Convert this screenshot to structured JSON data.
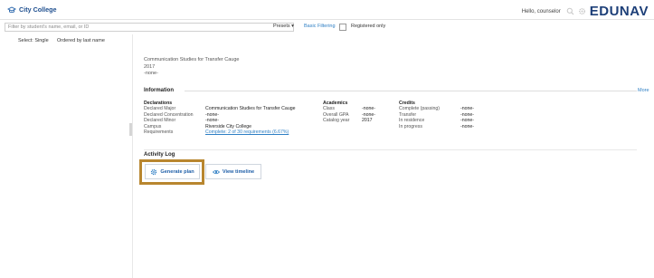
{
  "header": {
    "app_title": "City College",
    "greeting": "Hello, counselor",
    "brand": "EDUNAV"
  },
  "filter": {
    "search_placeholder": "Filter by student's name, email, or ID",
    "presets_label": "Presets ▾",
    "basic_filtering_label": "Basic Filtering",
    "registered_only_label": "Registered only"
  },
  "left_panel": {
    "select_label": "Select: Single",
    "order_label": "Ordered by last name"
  },
  "student": {
    "program": "Communication Studies for Transfer Cauge",
    "year": "2017",
    "extra": "-none-"
  },
  "information": {
    "heading": "Information",
    "more_label": "More",
    "declarations": {
      "heading": "Declarations",
      "rows": [
        {
          "label": "Declared Major",
          "value": "Communication Studies for Transfer Cauge"
        },
        {
          "label": "Declared Concentration",
          "value": "-none-"
        },
        {
          "label": "Declared Minor",
          "value": "-none-"
        },
        {
          "label": "Campus",
          "value": "Riverside City College"
        },
        {
          "label": "Requirements",
          "value": "Complete: 2 of 30 requirements (6.67%)"
        }
      ]
    },
    "academics": {
      "heading": "Academics",
      "rows": [
        {
          "label": "Class",
          "value": "-none-"
        },
        {
          "label": "Overall GPA",
          "value": "-none-"
        },
        {
          "label": "Catalog year",
          "value": "2017"
        }
      ]
    },
    "credits": {
      "heading": "Credits",
      "rows": [
        {
          "label": "Complete (passing)",
          "value": "-none-"
        },
        {
          "label": "Transfer",
          "value": "-none-"
        },
        {
          "label": "In residence",
          "value": "-none-"
        },
        {
          "label": "In progress",
          "value": "-none-"
        }
      ]
    }
  },
  "activity_log": {
    "heading": "Activity Log",
    "generate_plan_label": "Generate plan",
    "view_timeline_label": "View timeline"
  },
  "icons": {
    "logo": "graduation-cap-icon",
    "search": "search-icon",
    "settings": "gear-icon",
    "generate": "gear-icon",
    "timeline": "eye-icon"
  },
  "colors": {
    "brand_navy": "#1d3f78",
    "link_blue": "#2e7fc4",
    "highlight_gold": "#b8862f"
  }
}
